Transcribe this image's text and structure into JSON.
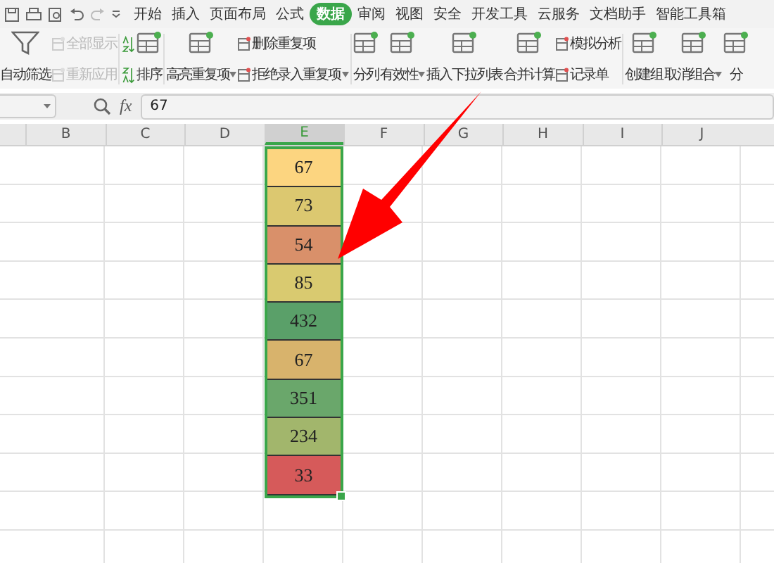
{
  "tabs": [
    {
      "label": "开始",
      "selected": false
    },
    {
      "label": "插入",
      "selected": false
    },
    {
      "label": "页面布局",
      "selected": false
    },
    {
      "label": "公式",
      "selected": false
    },
    {
      "label": "数据",
      "selected": true
    },
    {
      "label": "审阅",
      "selected": false
    },
    {
      "label": "视图",
      "selected": false
    },
    {
      "label": "安全",
      "selected": false
    },
    {
      "label": "开发工具",
      "selected": false
    },
    {
      "label": "云服务",
      "selected": false
    },
    {
      "label": "文档助手",
      "selected": false
    },
    {
      "label": "智能工具箱",
      "selected": false
    }
  ],
  "ribbon": [
    {
      "items": [
        {
          "kind": "large",
          "label": "自动筛选",
          "dropdown": false,
          "disabled": false
        },
        {
          "kind": "pair",
          "items": [
            {
              "label": "全部显示",
              "dropdown": false,
              "disabled": true
            },
            {
              "label": "重新应用",
              "dropdown": false,
              "disabled": true
            }
          ]
        }
      ]
    },
    {
      "items": [
        {
          "kind": "sorticons"
        },
        {
          "kind": "large",
          "label": "排序",
          "dropdown": false,
          "disabled": false
        }
      ]
    },
    {
      "items": [
        {
          "kind": "large",
          "label": "高亮重复项",
          "dropdown": true,
          "disabled": false
        },
        {
          "kind": "pair",
          "items": [
            {
              "label": "删除重复项",
              "dropdown": false,
              "disabled": false
            },
            {
              "label": "拒绝录入重复项",
              "dropdown": true,
              "disabled": false
            }
          ]
        }
      ]
    },
    {
      "items": [
        {
          "kind": "large",
          "label": "分列",
          "dropdown": false,
          "disabled": false
        },
        {
          "kind": "large",
          "label": "有效性",
          "dropdown": true,
          "disabled": false
        },
        {
          "kind": "large",
          "label": "插入下拉列表",
          "dropdown": false,
          "disabled": false
        },
        {
          "kind": "large",
          "label": "合并计算",
          "dropdown": false,
          "disabled": false
        },
        {
          "kind": "pair",
          "items": [
            {
              "label": "模拟分析",
              "dropdown": false,
              "disabled": false
            },
            {
              "label": "记录单",
              "dropdown": false,
              "disabled": false
            }
          ]
        }
      ]
    },
    {
      "items": [
        {
          "kind": "large",
          "label": "创建组",
          "dropdown": false,
          "disabled": false
        },
        {
          "kind": "large",
          "label": "取消组合",
          "dropdown": true,
          "disabled": false
        },
        {
          "kind": "large",
          "label": "分",
          "dropdown": false,
          "disabled": false
        }
      ]
    }
  ],
  "formula_bar": {
    "fx": "fx",
    "value": "67"
  },
  "sheet": {
    "columns": [
      {
        "label": "B",
        "selected": false
      },
      {
        "label": "C",
        "selected": false
      },
      {
        "label": "D",
        "selected": false
      },
      {
        "label": "E",
        "selected": true
      },
      {
        "label": "F",
        "selected": false
      },
      {
        "label": "G",
        "selected": false
      },
      {
        "label": "H",
        "selected": false
      },
      {
        "label": "I",
        "selected": false
      },
      {
        "label": "J",
        "selected": false
      }
    ],
    "cells": [
      {
        "value": "67",
        "color": "#fcd580"
      },
      {
        "value": "73",
        "color": "#dcc870"
      },
      {
        "value": "54",
        "color": "#d9906a"
      },
      {
        "value": "85",
        "color": "#d9ca70"
      },
      {
        "value": "432",
        "color": "#5aa069"
      },
      {
        "value": "67",
        "color": "#d8b36c"
      },
      {
        "value": "351",
        "color": "#6aa76b"
      },
      {
        "value": "234",
        "color": "#a2b66c"
      },
      {
        "value": "33",
        "color": "#d65a5a"
      }
    ]
  }
}
